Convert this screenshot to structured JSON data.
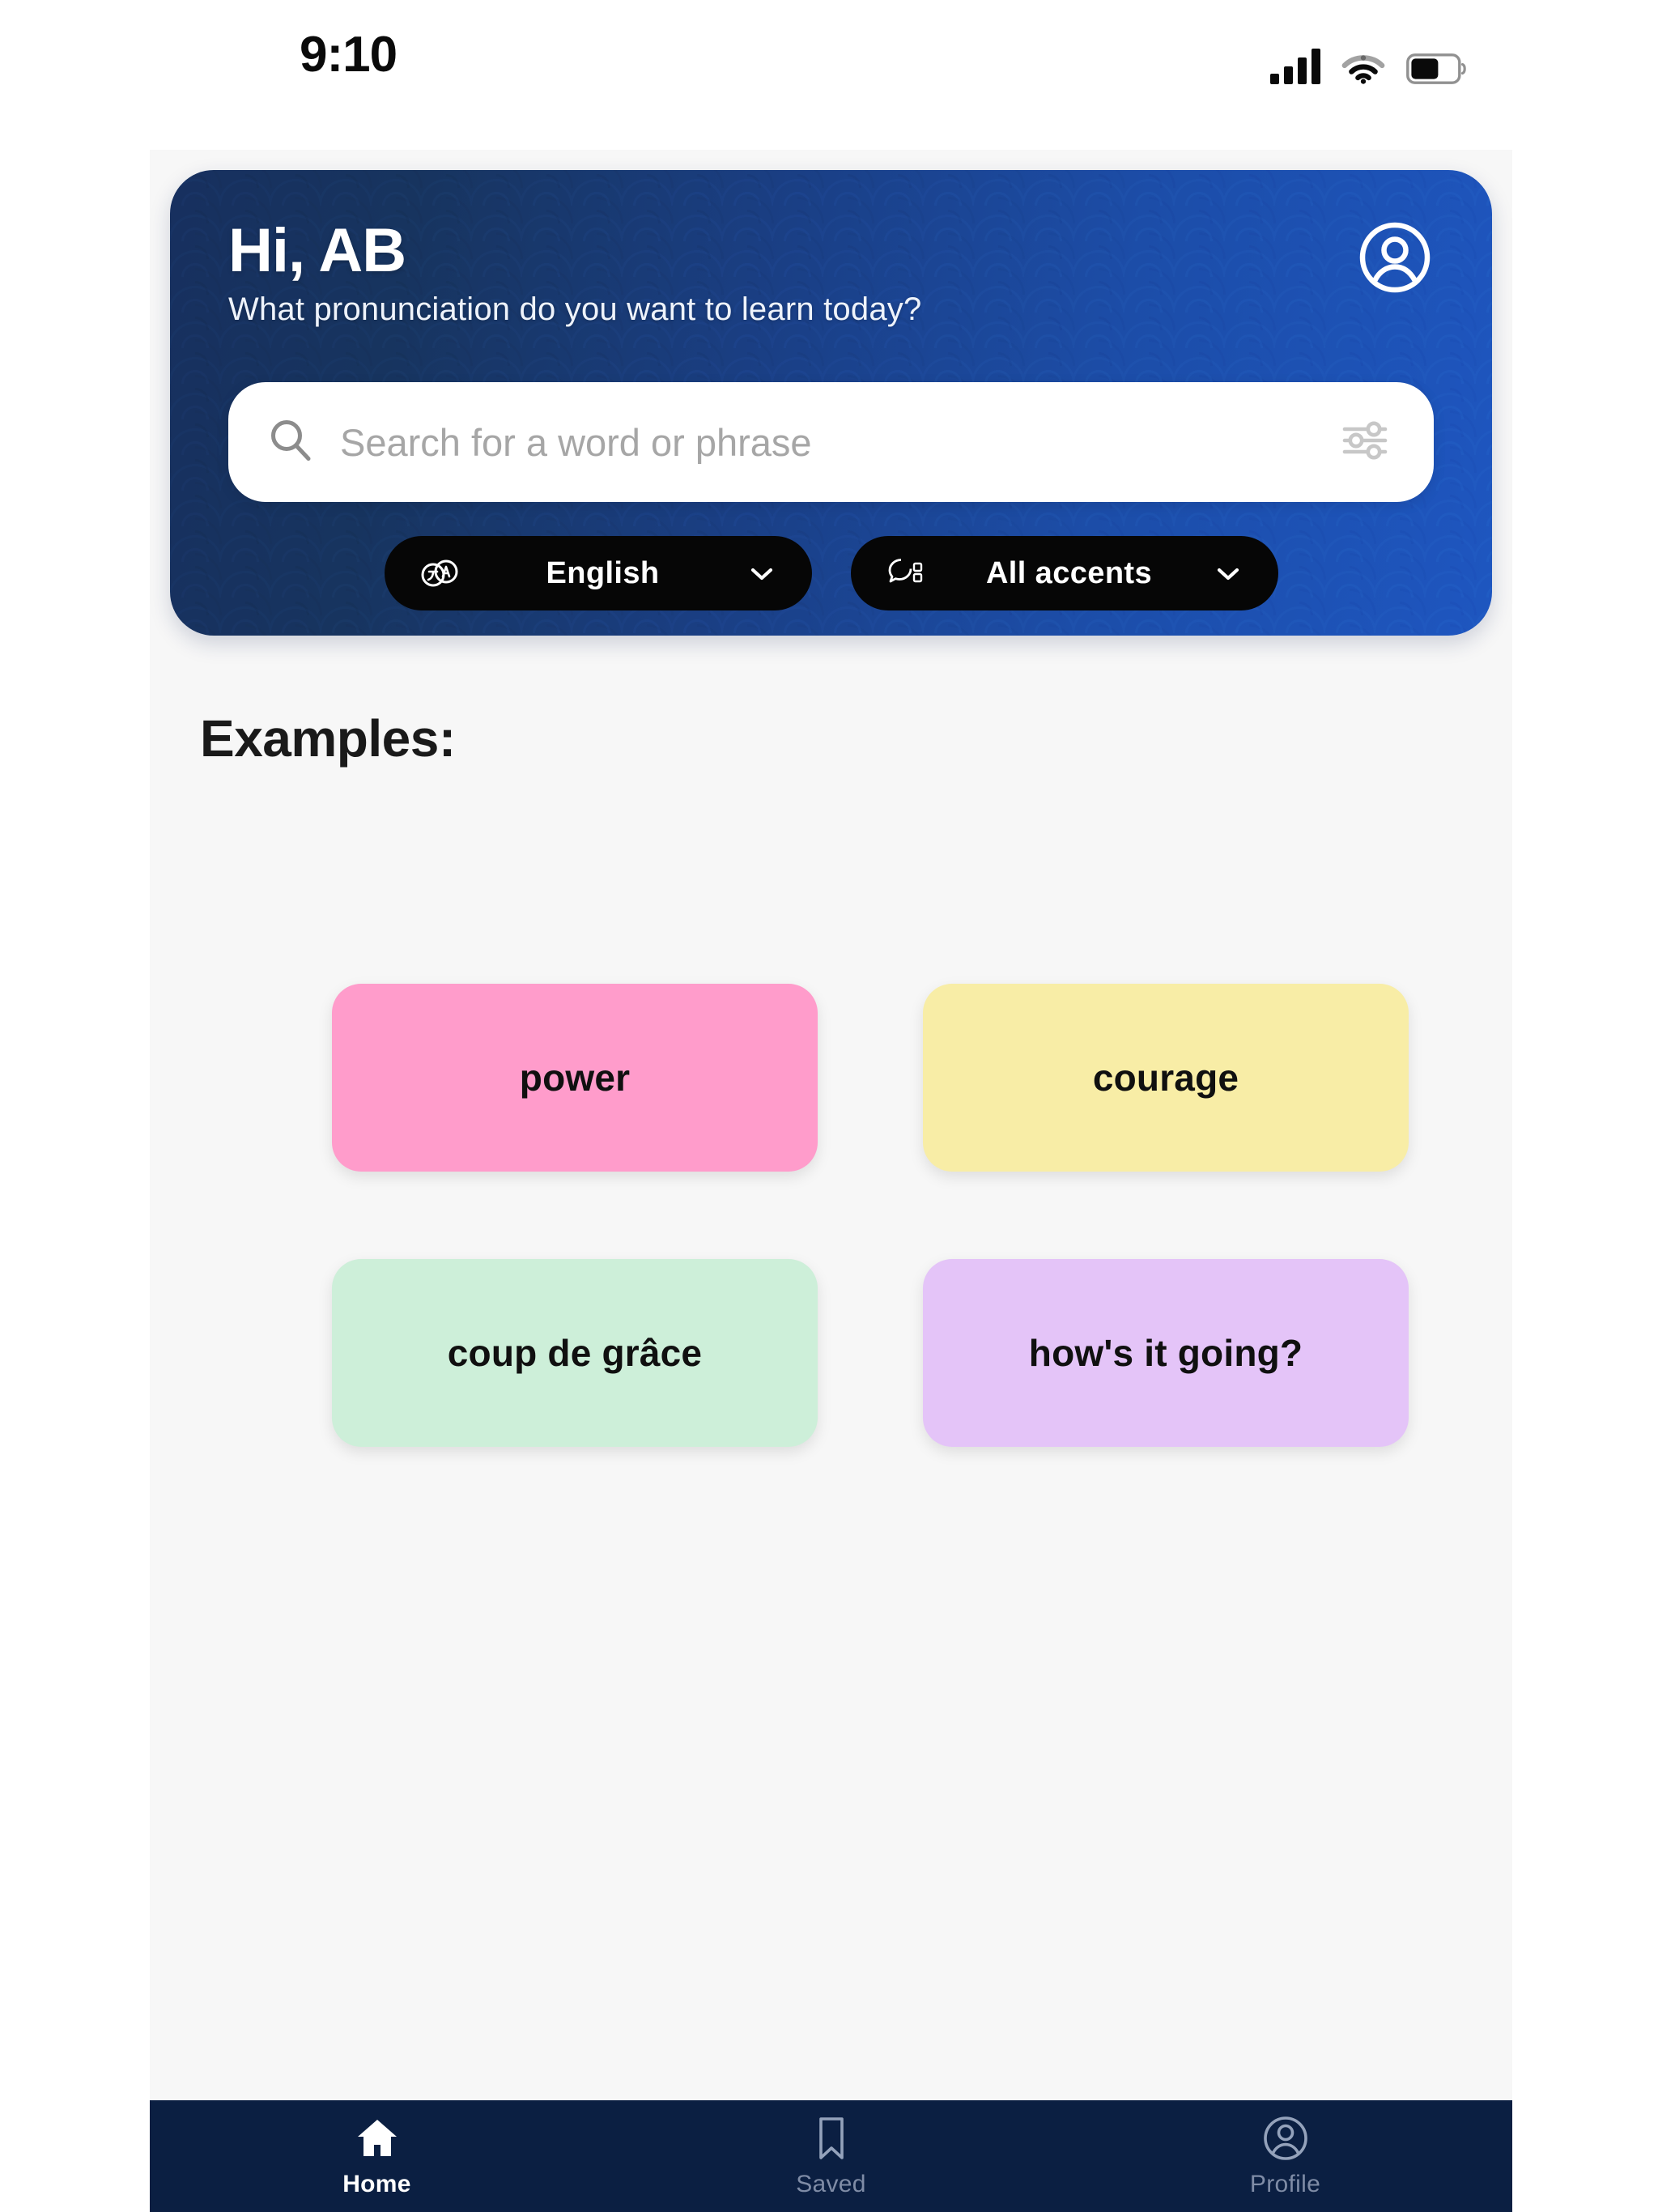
{
  "status_bar": {
    "time": "9:10",
    "signal_icon": "cellular-signal-icon",
    "signal_bars": 4,
    "wifi_icon": "wifi-icon",
    "battery_icon": "battery-icon",
    "battery_level_pct": 55
  },
  "header": {
    "greeting": "Hi, AB",
    "subtitle": "What pronunciation do you want to learn today?",
    "avatar_icon": "account-circle-icon",
    "gradient_from": "#17305f",
    "gradient_to": "#1e56c0"
  },
  "search": {
    "placeholder": "Search for a word or phrase",
    "value": "",
    "search_icon": "search-icon",
    "filter_icon": "filter-sliders-icon"
  },
  "filters": {
    "language": {
      "label": "English",
      "icon": "translate-icon",
      "chevron": "chevron-down-icon"
    },
    "accent": {
      "label": "All accents",
      "icon": "speech-bubble-icon",
      "chevron": "chevron-down-icon"
    }
  },
  "main": {
    "examples_heading": "Examples:",
    "cards": [
      {
        "label": "power",
        "color": "#ff9ccb"
      },
      {
        "label": "courage",
        "color": "#f8eda6"
      },
      {
        "label": "coup de grâce",
        "color": "#cdefd9"
      },
      {
        "label": "how's it going?",
        "color": "#e4c4f8"
      }
    ]
  },
  "bottom_nav": {
    "background": "#0b1f42",
    "items": [
      {
        "label": "Home",
        "icon": "home-icon",
        "active": true
      },
      {
        "label": "Saved",
        "icon": "bookmark-icon",
        "active": false
      },
      {
        "label": "Profile",
        "icon": "account-circle-icon",
        "active": false
      }
    ]
  }
}
